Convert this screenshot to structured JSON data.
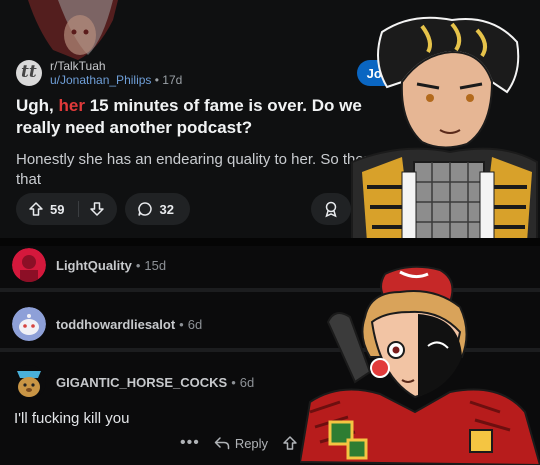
{
  "post": {
    "subreddit": "r/TalkTuah",
    "author": "u/Jonathan_Philips",
    "age": "17d",
    "join_label": "Join",
    "title_prefix": "Ugh, ",
    "title_highlight": "her",
    "title_rest": " 15 minutes of fame is over. Do we really need another podcast?",
    "body": "Honestly she has an endearing quality to her. So there's that",
    "upvotes": "59",
    "comments": "32",
    "more_glyph": "y"
  },
  "comments": [
    {
      "author": "LightQuality",
      "age": "15d"
    },
    {
      "author": "toddhowardliesalot",
      "age": "6d"
    },
    {
      "author": "GIGANTIC_HORSE_COCKS",
      "age": "6d",
      "body": "I'll fucking kill you",
      "reply_label": "Reply",
      "more": "•••"
    }
  ],
  "colors": {
    "accent": "#0a66c2",
    "highlight": "#e03a3a",
    "link": "#6f9fd8"
  }
}
